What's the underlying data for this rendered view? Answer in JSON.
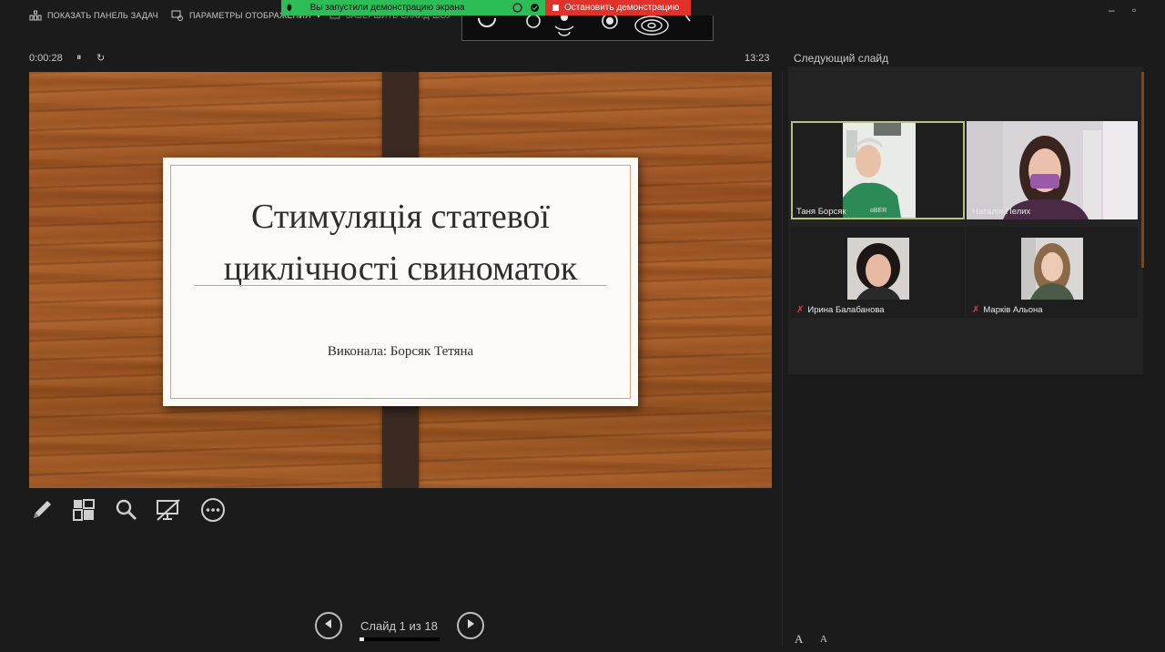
{
  "toolbar": {
    "show_taskbar": "ПОКАЗАТЬ ПАНЕЛЬ ЗАДАЧ",
    "display_settings": "ПАРАМЕТРЫ ОТОБРАЖЕНИЯ",
    "display_settings_arrow": "▾",
    "end_show": "ЗАВЕРШИТЬ СЛАЙД-ШОУ",
    "minimize": "–",
    "restore": "▫"
  },
  "share_bar": {
    "status": "Вы запустили демонстрацию экрана",
    "stop": "Остановить демонстрацию"
  },
  "presenter": {
    "elapsed": "0:00:28",
    "pause_icon": "⏸",
    "reset_icon": "↻",
    "clock": "13:23",
    "next_slide_label": "Следующий слайд"
  },
  "slide": {
    "title": "Стимуляція статевої циклічності свиноматок",
    "subtitle": "Виконала: Борсяк Тетяна"
  },
  "navigation": {
    "counter": "Слайд 1 из 18",
    "current": 1,
    "total": 18
  },
  "participants": [
    {
      "name": "Таня Борсяк",
      "muted": false,
      "active": true
    },
    {
      "name": "Наталія Пелих",
      "muted": false,
      "active": false
    },
    {
      "name": "Ирина Балабанова",
      "muted": true,
      "active": false
    },
    {
      "name": "Марків Альона",
      "muted": true,
      "active": false
    }
  ],
  "font_controls": {
    "increase": "A",
    "decrease": "A"
  },
  "colors": {
    "share_green": "#2dbd57",
    "share_red": "#e0312a",
    "active_tile": "#b6c27b"
  }
}
